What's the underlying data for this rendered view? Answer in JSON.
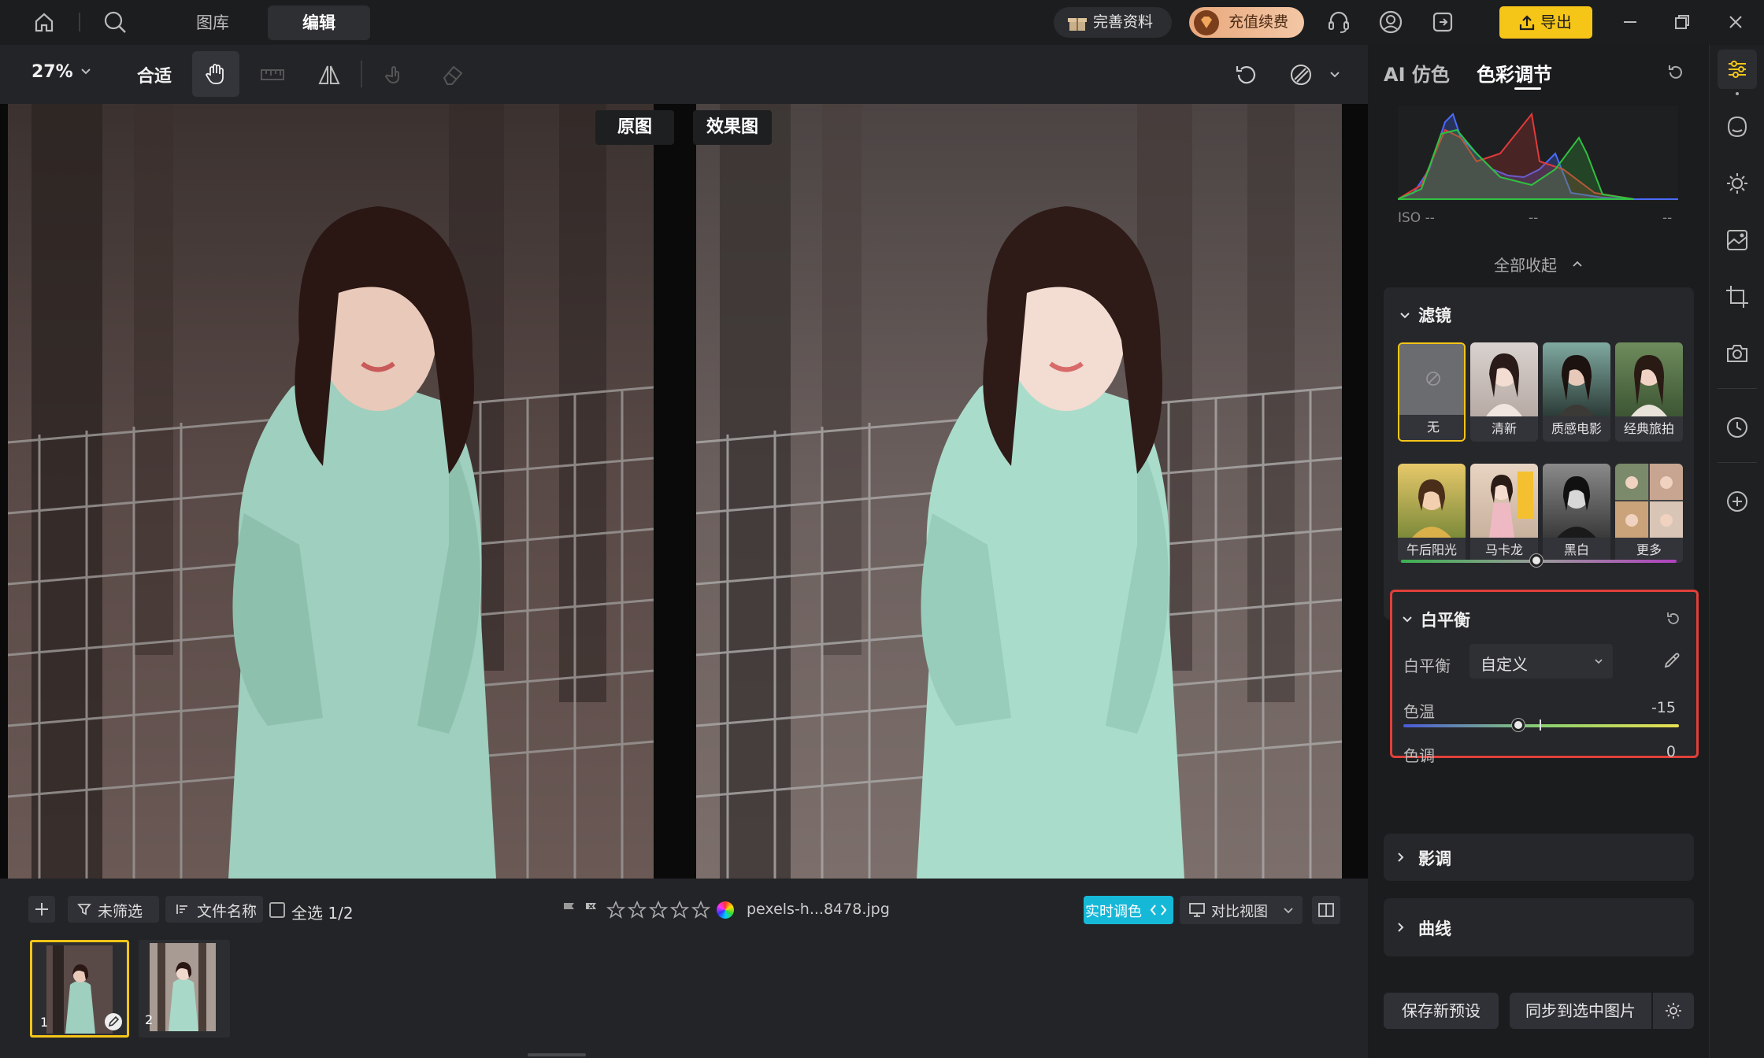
{
  "topbar": {
    "tabs": [
      "图库",
      "编辑"
    ],
    "profile_label": "完善资料",
    "recharge_label": "充值续费",
    "export_label": "导出"
  },
  "toolbar": {
    "zoom": "27%",
    "fit_label": "合适"
  },
  "canvas": {
    "original_label": "原图",
    "effect_label": "效果图"
  },
  "bottombar": {
    "filter_label": "未筛选",
    "sort_label": "文件名称",
    "select_all_label": "全选 1/2",
    "filename": "pexels-h...8478.jpg",
    "realtime_label": "实时调色",
    "compare_view_label": "对比视图",
    "thumbnails": [
      {
        "num": "1"
      },
      {
        "num": "2"
      }
    ]
  },
  "panel": {
    "tabs": [
      "AI 仿色",
      "色彩调节"
    ],
    "histogram": {
      "iso": "ISO --",
      "mid": "--",
      "right": "--"
    },
    "collapse_all_label": "全部收起",
    "filters": {
      "title": "滤镜",
      "items": [
        "无",
        "清新",
        "质感电影",
        "经典旅拍",
        "午后阳光",
        "马卡龙",
        "黑白",
        "更多"
      ]
    },
    "white_balance": {
      "title": "白平衡",
      "wb_label": "白平衡",
      "wb_value": "自定义",
      "temp_label": "色温",
      "temp_value": "-15",
      "temp_level": -15,
      "tint_label": "色调",
      "tint_value": "0",
      "tint_level": 0
    },
    "tone": {
      "title": "影调"
    },
    "curves": {
      "title": "曲线"
    },
    "save_preset_label": "保存新预设",
    "sync_label": "同步到选中图片"
  },
  "colors": {
    "accent_yellow": "#f5c518",
    "highlight_red": "#e0403a",
    "realtime_cyan": "#16b8d8"
  }
}
